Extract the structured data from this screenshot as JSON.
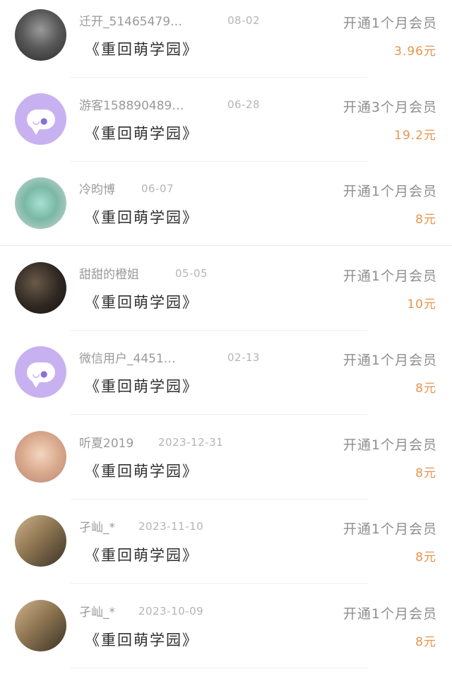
{
  "items": [
    {
      "name": "迁开_51465479…",
      "date": "08-02",
      "title": "《重回萌学园》",
      "plan": "开通1个月会员",
      "price": "3.96元",
      "avatar": "photo-dark"
    },
    {
      "name": "游客158890489…",
      "date": "06-28",
      "title": "《重回萌学园》",
      "plan": "开通3个月会员",
      "price": "19.2元",
      "avatar": "default"
    },
    {
      "name": "冷昀博",
      "date": "06-07",
      "title": "《重回萌学园》",
      "plan": "开通1个月会员",
      "price": "8元",
      "avatar": "photo-mint"
    },
    {
      "name": "甜甜的橙姐",
      "date": "05-05",
      "title": "《重回萌学园》",
      "plan": "开通1个月会员",
      "price": "10元",
      "avatar": "photo-night"
    },
    {
      "name": "微信用户_4451…",
      "date": "02-13",
      "title": "《重回萌学园》",
      "plan": "开通1个月会员",
      "price": "8元",
      "avatar": "default"
    },
    {
      "name": "听夏2019",
      "date": "2023-12-31",
      "title": "《重回萌学园》",
      "plan": "开通1个月会员",
      "price": "8元",
      "avatar": "photo-warm"
    },
    {
      "name": "孑屾_*",
      "date": "2023-11-10",
      "title": "《重回萌学园》",
      "plan": "开通1个月会员",
      "price": "8元",
      "avatar": "photo-sepia"
    },
    {
      "name": "孑屾_*",
      "date": "2023-10-09",
      "title": "《重回萌学园》",
      "plan": "开通1个月会员",
      "price": "8元",
      "avatar": "photo-sepia"
    }
  ]
}
